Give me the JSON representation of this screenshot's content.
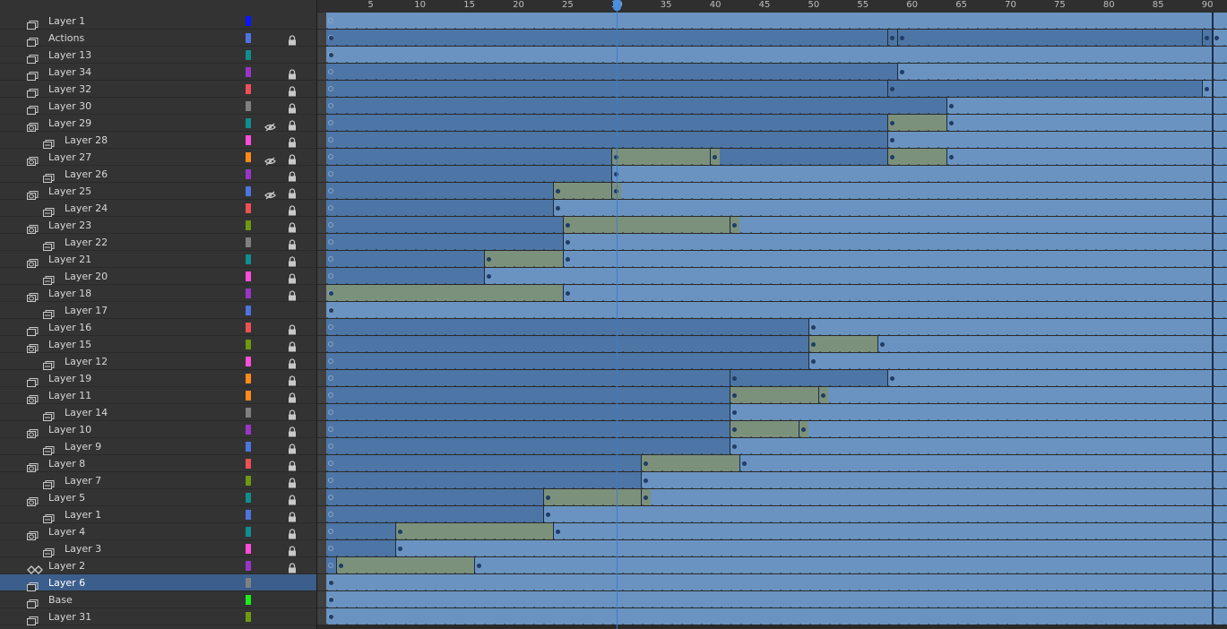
{
  "ruler": {
    "labels": [
      "5",
      "10",
      "15",
      "20",
      "25",
      "30",
      "35",
      "40",
      "45",
      "50",
      "55",
      "60",
      "65",
      "70",
      "75",
      "80",
      "85",
      "90"
    ],
    "current_frame": 30
  },
  "colors": {
    "keyframe_span": "#4d75a5",
    "empty_span": "#6a93c1",
    "tween_span": "#7b917c",
    "selected_layer": "#3b5e8c",
    "playhead": "#3a7fd0"
  },
  "layers": [
    {
      "name": "Layer 1",
      "indent": 0,
      "icon": "layer-icon",
      "color": "#0a14ff",
      "eye": false,
      "lock": false,
      "selected": false,
      "keys": [],
      "tweens": []
    },
    {
      "name": "Actions",
      "indent": 0,
      "icon": "layer-icon",
      "color": "#4d74e0",
      "eye": false,
      "lock": true,
      "selected": false,
      "keys": [
        1,
        58,
        59,
        90,
        91
      ],
      "tweens": []
    },
    {
      "name": "Layer 13",
      "indent": 0,
      "icon": "layer-icon",
      "color": "#0f8f8f",
      "eye": false,
      "lock": false,
      "selected": false,
      "keys": [
        1
      ],
      "tweens": []
    },
    {
      "name": "Layer 34",
      "indent": 0,
      "icon": "layer-icon",
      "color": "#9a35c9",
      "eye": false,
      "lock": true,
      "selected": false,
      "keys": [
        59
      ],
      "tweens": []
    },
    {
      "name": "Layer 32",
      "indent": 0,
      "icon": "layer-icon",
      "color": "#ef4f55",
      "eye": false,
      "lock": true,
      "selected": false,
      "keys": [
        58,
        90
      ],
      "tweens": []
    },
    {
      "name": "Layer 30",
      "indent": 0,
      "icon": "layer-icon",
      "color": "#808080",
      "eye": false,
      "lock": true,
      "selected": false,
      "keys": [
        64
      ],
      "tweens": []
    },
    {
      "name": "Layer 29",
      "indent": 0,
      "icon": "mask-icon",
      "color": "#0f8f8f",
      "eye": true,
      "lock": true,
      "selected": false,
      "keys": [
        58,
        64
      ],
      "tweens": [
        [
          58,
          63
        ]
      ]
    },
    {
      "name": "Layer 28",
      "indent": 1,
      "icon": "masked-icon",
      "color": "#ff4ddb",
      "eye": false,
      "lock": true,
      "selected": false,
      "keys": [
        58
      ],
      "tweens": []
    },
    {
      "name": "Layer 27",
      "indent": 0,
      "icon": "mask-icon",
      "color": "#ff8a1a",
      "eye": true,
      "lock": true,
      "selected": false,
      "keys": [
        30,
        40,
        58,
        64
      ],
      "tweens": [
        [
          30,
          40
        ],
        [
          58,
          63
        ]
      ]
    },
    {
      "name": "Layer 26",
      "indent": 1,
      "icon": "masked-icon",
      "color": "#9a35c9",
      "eye": false,
      "lock": true,
      "selected": false,
      "keys": [
        30
      ],
      "tweens": []
    },
    {
      "name": "Layer 25",
      "indent": 0,
      "icon": "mask-icon",
      "color": "#4d74e0",
      "eye": true,
      "lock": true,
      "selected": false,
      "keys": [
        24,
        30
      ],
      "tweens": [
        [
          24,
          30
        ]
      ]
    },
    {
      "name": "Layer 24",
      "indent": 1,
      "icon": "masked-icon",
      "color": "#ef4f55",
      "eye": false,
      "lock": true,
      "selected": false,
      "keys": [
        24
      ],
      "tweens": []
    },
    {
      "name": "Layer 23",
      "indent": 0,
      "icon": "mask-icon",
      "color": "#6e9a12",
      "eye": false,
      "lock": true,
      "selected": false,
      "keys": [
        25,
        42
      ],
      "tweens": [
        [
          25,
          42
        ]
      ]
    },
    {
      "name": "Layer 22",
      "indent": 1,
      "icon": "masked-icon",
      "color": "#808080",
      "eye": false,
      "lock": true,
      "selected": false,
      "keys": [
        25
      ],
      "tweens": []
    },
    {
      "name": "Layer 21",
      "indent": 0,
      "icon": "mask-icon",
      "color": "#0f8f8f",
      "eye": false,
      "lock": true,
      "selected": false,
      "keys": [
        17,
        25
      ],
      "tweens": [
        [
          17,
          24
        ]
      ]
    },
    {
      "name": "Layer 20",
      "indent": 1,
      "icon": "masked-icon",
      "color": "#ff4ddb",
      "eye": false,
      "lock": true,
      "selected": false,
      "keys": [
        17
      ],
      "tweens": []
    },
    {
      "name": "Layer 18",
      "indent": 0,
      "icon": "mask-icon",
      "color": "#9a35c9",
      "eye": false,
      "lock": true,
      "selected": false,
      "keys": [
        1,
        25
      ],
      "tweens": [
        [
          1,
          24
        ]
      ]
    },
    {
      "name": "Layer 17",
      "indent": 1,
      "icon": "masked-icon",
      "color": "#4d74e0",
      "eye": false,
      "lock": false,
      "selected": false,
      "keys": [
        1
      ],
      "tweens": []
    },
    {
      "name": "Layer 16",
      "indent": 0,
      "icon": "layer-icon",
      "color": "#ef4f55",
      "eye": false,
      "lock": true,
      "selected": false,
      "keys": [
        50
      ],
      "tweens": []
    },
    {
      "name": "Layer 15",
      "indent": 0,
      "icon": "mask-icon",
      "color": "#6e9a12",
      "eye": false,
      "lock": true,
      "selected": false,
      "keys": [
        50,
        57
      ],
      "tweens": [
        [
          50,
          56
        ]
      ]
    },
    {
      "name": "Layer 12",
      "indent": 1,
      "icon": "masked-icon",
      "color": "#ff4ddb",
      "eye": false,
      "lock": true,
      "selected": false,
      "keys": [
        50
      ],
      "tweens": []
    },
    {
      "name": "Layer 19",
      "indent": 0,
      "icon": "layer-icon",
      "color": "#ff8a1a",
      "eye": false,
      "lock": true,
      "selected": false,
      "keys": [
        42,
        58
      ],
      "tweens": []
    },
    {
      "name": "Layer 11",
      "indent": 0,
      "icon": "mask-icon",
      "color": "#ff8a1a",
      "eye": false,
      "lock": true,
      "selected": false,
      "keys": [
        42,
        51
      ],
      "tweens": [
        [
          42,
          51
        ]
      ]
    },
    {
      "name": "Layer 14",
      "indent": 1,
      "icon": "masked-icon",
      "color": "#808080",
      "eye": false,
      "lock": true,
      "selected": false,
      "keys": [
        42
      ],
      "tweens": []
    },
    {
      "name": "Layer 10",
      "indent": 0,
      "icon": "mask-icon",
      "color": "#9a35c9",
      "eye": false,
      "lock": true,
      "selected": false,
      "keys": [
        42,
        49
      ],
      "tweens": [
        [
          42,
          49
        ]
      ]
    },
    {
      "name": "Layer 9",
      "indent": 1,
      "icon": "masked-icon",
      "color": "#4d74e0",
      "eye": false,
      "lock": true,
      "selected": false,
      "keys": [
        42
      ],
      "tweens": []
    },
    {
      "name": "Layer 8",
      "indent": 0,
      "icon": "mask-icon",
      "color": "#ef4f55",
      "eye": false,
      "lock": true,
      "selected": false,
      "keys": [
        33,
        43
      ],
      "tweens": [
        [
          33,
          42
        ]
      ]
    },
    {
      "name": "Layer 7",
      "indent": 1,
      "icon": "masked-icon",
      "color": "#6e9a12",
      "eye": false,
      "lock": true,
      "selected": false,
      "keys": [
        33
      ],
      "tweens": []
    },
    {
      "name": "Layer 5",
      "indent": 0,
      "icon": "mask-icon",
      "color": "#0f8f8f",
      "eye": false,
      "lock": true,
      "selected": false,
      "keys": [
        23,
        33
      ],
      "tweens": [
        [
          23,
          33
        ]
      ]
    },
    {
      "name": "Layer 1",
      "indent": 1,
      "icon": "masked-icon",
      "color": "#4d74e0",
      "eye": false,
      "lock": true,
      "selected": false,
      "keys": [
        23
      ],
      "tweens": []
    },
    {
      "name": "Layer 4",
      "indent": 0,
      "icon": "mask-icon",
      "color": "#0f8f8f",
      "eye": false,
      "lock": true,
      "selected": false,
      "keys": [
        8,
        24
      ],
      "tweens": [
        [
          8,
          23
        ]
      ]
    },
    {
      "name": "Layer 3",
      "indent": 1,
      "icon": "masked-icon",
      "color": "#ff4ddb",
      "eye": false,
      "lock": true,
      "selected": false,
      "keys": [
        8
      ],
      "tweens": []
    },
    {
      "name": "Layer 2",
      "indent": 0,
      "icon": "guide-icon",
      "color": "#9a35c9",
      "eye": false,
      "lock": true,
      "selected": false,
      "keys": [
        2,
        16
      ],
      "tweens": [
        [
          2,
          15
        ]
      ]
    },
    {
      "name": "Layer 6",
      "indent": 0,
      "icon": "layer-icon",
      "color": "#808080",
      "eye": false,
      "lock": false,
      "selected": true,
      "keys": [
        1
      ],
      "tweens": []
    },
    {
      "name": "Base",
      "indent": 0,
      "icon": "layer-icon",
      "color": "#1aee1a",
      "eye": false,
      "lock": false,
      "selected": false,
      "keys": [
        1
      ],
      "tweens": []
    },
    {
      "name": "Layer 31",
      "indent": 0,
      "icon": "layer-icon",
      "color": "#6e9a12",
      "eye": false,
      "lock": false,
      "selected": false,
      "keys": [
        1
      ],
      "tweens": []
    }
  ]
}
